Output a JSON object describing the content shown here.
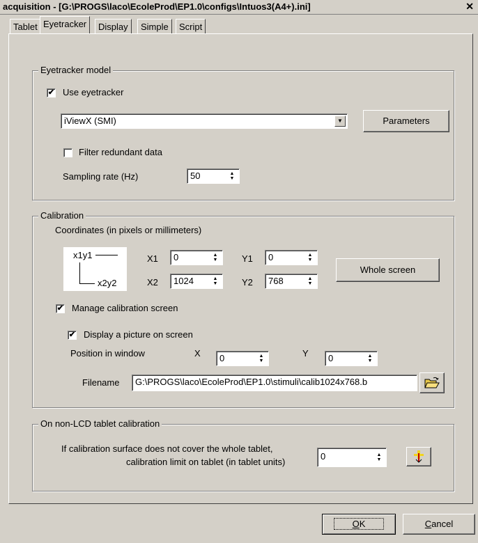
{
  "window": {
    "title": "acquisition - [G:\\PROGS\\laco\\EcoleProd\\EP1.0\\configs\\Intuos3(A4+).ini]",
    "close_glyph": "✕"
  },
  "tabs": [
    {
      "label": "Tablet",
      "active": false
    },
    {
      "label": "Eyetracker",
      "active": true
    },
    {
      "label": "Display",
      "active": false
    },
    {
      "label": "Simple",
      "active": false
    },
    {
      "label": "Script",
      "active": false
    }
  ],
  "eyetracker_model": {
    "legend": "Eyetracker model",
    "use_eyetracker_label": "Use eyetracker",
    "use_eyetracker_checked": true,
    "model_value": "iViewX (SMI)",
    "parameters_label": "Parameters",
    "filter_label": "Filter redundant data",
    "filter_checked": false,
    "sampling_label": "Sampling rate (Hz)",
    "sampling_value": "50"
  },
  "calibration": {
    "legend": "Calibration",
    "coords_label": "Coordinates (in pixels or millimeters)",
    "diagram_tl": "x1y1",
    "diagram_br": "x2y2",
    "x1_label": "X1",
    "x1_value": "0",
    "y1_label": "Y1",
    "y1_value": "0",
    "x2_label": "X2",
    "x2_value": "1024",
    "y2_label": "Y2",
    "y2_value": "768",
    "whole_screen_label": "Whole screen",
    "manage_label": "Manage calibration screen",
    "manage_checked": true,
    "display_picture_label": "Display a picture on screen",
    "display_picture_checked": true,
    "position_label": "Position in window",
    "pos_x_label": "X",
    "pos_x_value": "0",
    "pos_y_label": "Y",
    "pos_y_value": "0",
    "filename_label": "Filename",
    "filename_value": "G:\\PROGS\\laco\\EcoleProd\\EP1.0\\stimuli\\calib1024x768.b"
  },
  "nonlcd": {
    "legend": "On non-LCD tablet calibration",
    "desc_line1": "If calibration surface does not cover the whole tablet,",
    "desc_line2": "calibration limit on tablet (in tablet units)",
    "value": "0"
  },
  "footer": {
    "ok_mnemonic": "O",
    "ok_rest": "K",
    "cancel_mnemonic": "C",
    "cancel_rest": "ancel"
  },
  "icons": {
    "check": "✔",
    "spin_up": "▲",
    "spin_down": "▼",
    "dropdown": "▼"
  }
}
